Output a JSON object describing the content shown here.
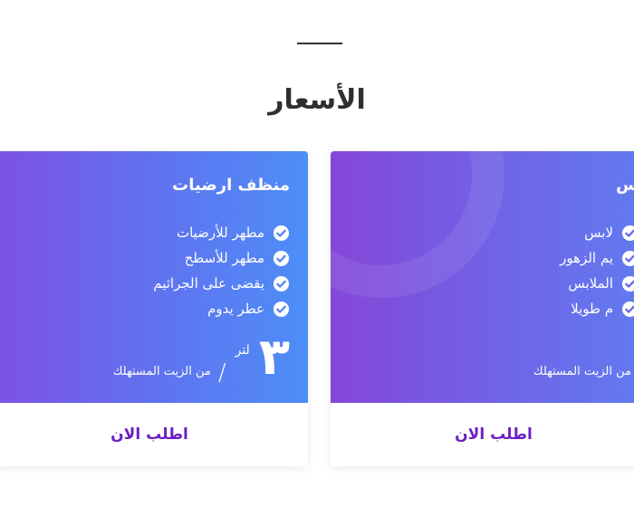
{
  "section": {
    "title": "الأسعار"
  },
  "cards": [
    {
      "name": "منظف ارضيات",
      "features": [
        "مطهر للأرضيات",
        "مطهر للأسطح",
        "يقضى على الجراثيم",
        "عطر يدوم"
      ],
      "price": "٣",
      "unit": "لتر",
      "note": "من الزيت المستهلك",
      "cta": "اطلب الان"
    },
    {
      "name": "س",
      "features": [
        "لابس",
        "يم الزهور",
        "الملابس",
        "م طويلا"
      ],
      "price": "",
      "unit": "",
      "note": "من الزيت المستهلك",
      "cta": "اطلب الان"
    }
  ],
  "icons": {
    "check": "check-circle-icon"
  },
  "colors": {
    "accent": "#6a1fc4",
    "gradient_start": "#7d51e3",
    "gradient_end": "#4d8ef8"
  }
}
